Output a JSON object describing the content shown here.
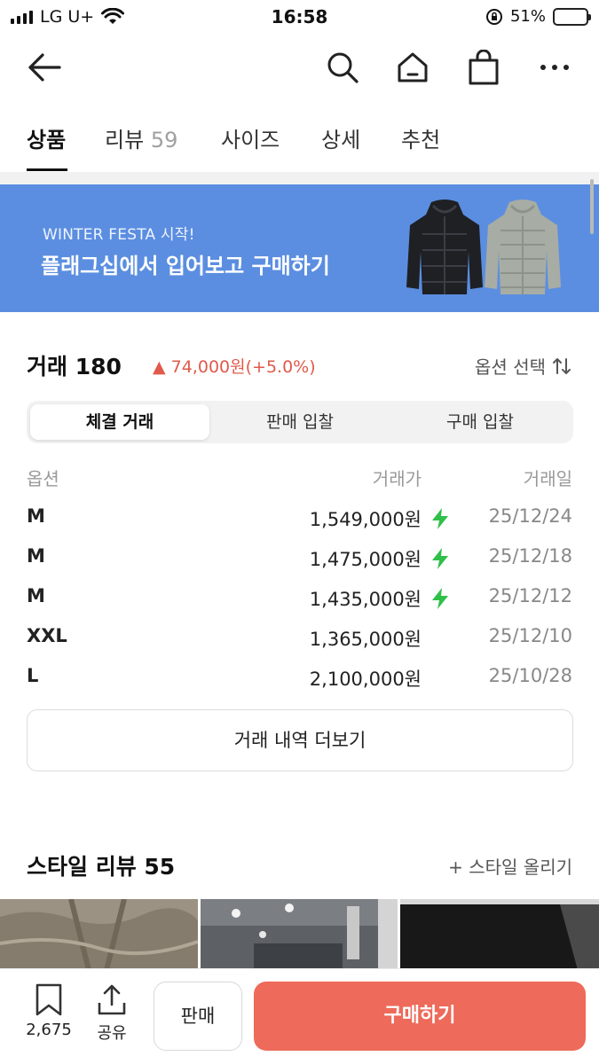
{
  "status_bar": {
    "carrier": "LG U+",
    "time": "16:58",
    "battery_pct": "51%",
    "battery_level": 0.51
  },
  "tabs": [
    {
      "label": "상품"
    },
    {
      "label": "리뷰",
      "count": "59"
    },
    {
      "label": "사이즈"
    },
    {
      "label": "상세"
    },
    {
      "label": "추천"
    }
  ],
  "banner": {
    "subtitle": "WINTER FESTA 시작!",
    "title": "플래그십에서 입어보고 구매하기",
    "bg_color": "#5b8ee0"
  },
  "trade": {
    "title": "거래 180",
    "change": "▲ 74,000원(+5.0%)",
    "change_color": "#e05a4c",
    "option_select": "옵션 선택",
    "segments": [
      "체결 거래",
      "판매 입찰",
      "구매 입찰"
    ],
    "columns": [
      "옵션",
      "거래가",
      "거래일"
    ],
    "rows": [
      {
        "size": "M",
        "price": "1,549,000원",
        "fast": true,
        "date": "25/12/24"
      },
      {
        "size": "M",
        "price": "1,475,000원",
        "fast": true,
        "date": "25/12/18"
      },
      {
        "size": "M",
        "price": "1,435,000원",
        "fast": true,
        "date": "25/12/12"
      },
      {
        "size": "XXL",
        "price": "1,365,000원",
        "fast": false,
        "date": "25/12/10"
      },
      {
        "size": "L",
        "price": "2,100,000원",
        "fast": false,
        "date": "25/10/28"
      }
    ],
    "more_label": "거래 내역 더보기"
  },
  "style_review": {
    "title": "스타일 리뷰 55",
    "add_label": "+ 스타일 올리기"
  },
  "bottom_bar": {
    "bookmark_count": "2,675",
    "share_label": "공유",
    "sell_label": "판매",
    "buy_label": "구매하기",
    "buy_color": "#ee6a5a"
  }
}
